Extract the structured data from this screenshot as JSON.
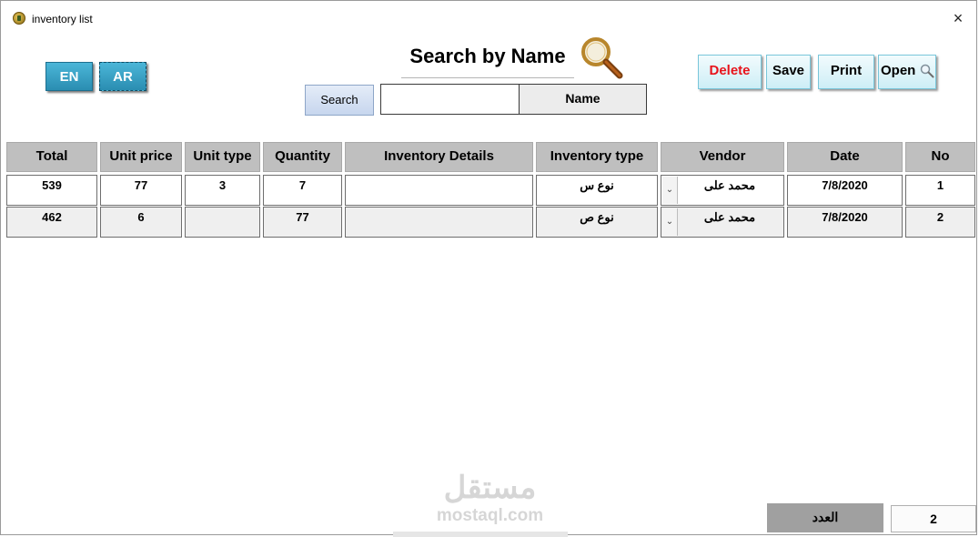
{
  "window": {
    "title": "inventory list",
    "close_glyph": "×"
  },
  "lang": {
    "en_label": "EN",
    "ar_label": "AR"
  },
  "search": {
    "title": "Search by Name",
    "button_label": "Search",
    "input_value": "",
    "field_label": "Name"
  },
  "toolbar": {
    "delete_label": "Delete",
    "save_label": "Save",
    "print_label": "Print",
    "open_label": "Open"
  },
  "table": {
    "headers": {
      "total": "Total",
      "unit_price": "Unit price",
      "unit_type": "Unit type",
      "quantity": "Quantity",
      "inventory_details": "Inventory Details",
      "inventory_type": "Inventory type",
      "vendor": "Vendor",
      "date": "Date",
      "no": "No"
    },
    "rows": [
      {
        "total": "539",
        "unit_price": "77",
        "unit_type": "3",
        "quantity": "7",
        "inventory_details": "",
        "inventory_type": "نوع س",
        "vendor": "محمد على",
        "date": "7/8/2020",
        "no": "1"
      },
      {
        "total": "462",
        "unit_price": "6",
        "unit_type": "",
        "quantity": "77",
        "inventory_details": "",
        "inventory_type": "نوع ص",
        "vendor": "محمد على",
        "date": "7/8/2020",
        "no": "2"
      }
    ],
    "dropdown_glyph": "⌄"
  },
  "footer": {
    "count_label": "العدد",
    "count_value": "2"
  },
  "watermark": {
    "arabic": "مستقل",
    "latin": "mostaql.com"
  },
  "colors": {
    "delete": "#e8131b",
    "header_bg": "#bfbfbf",
    "lang_btn": "#2a8db1"
  }
}
